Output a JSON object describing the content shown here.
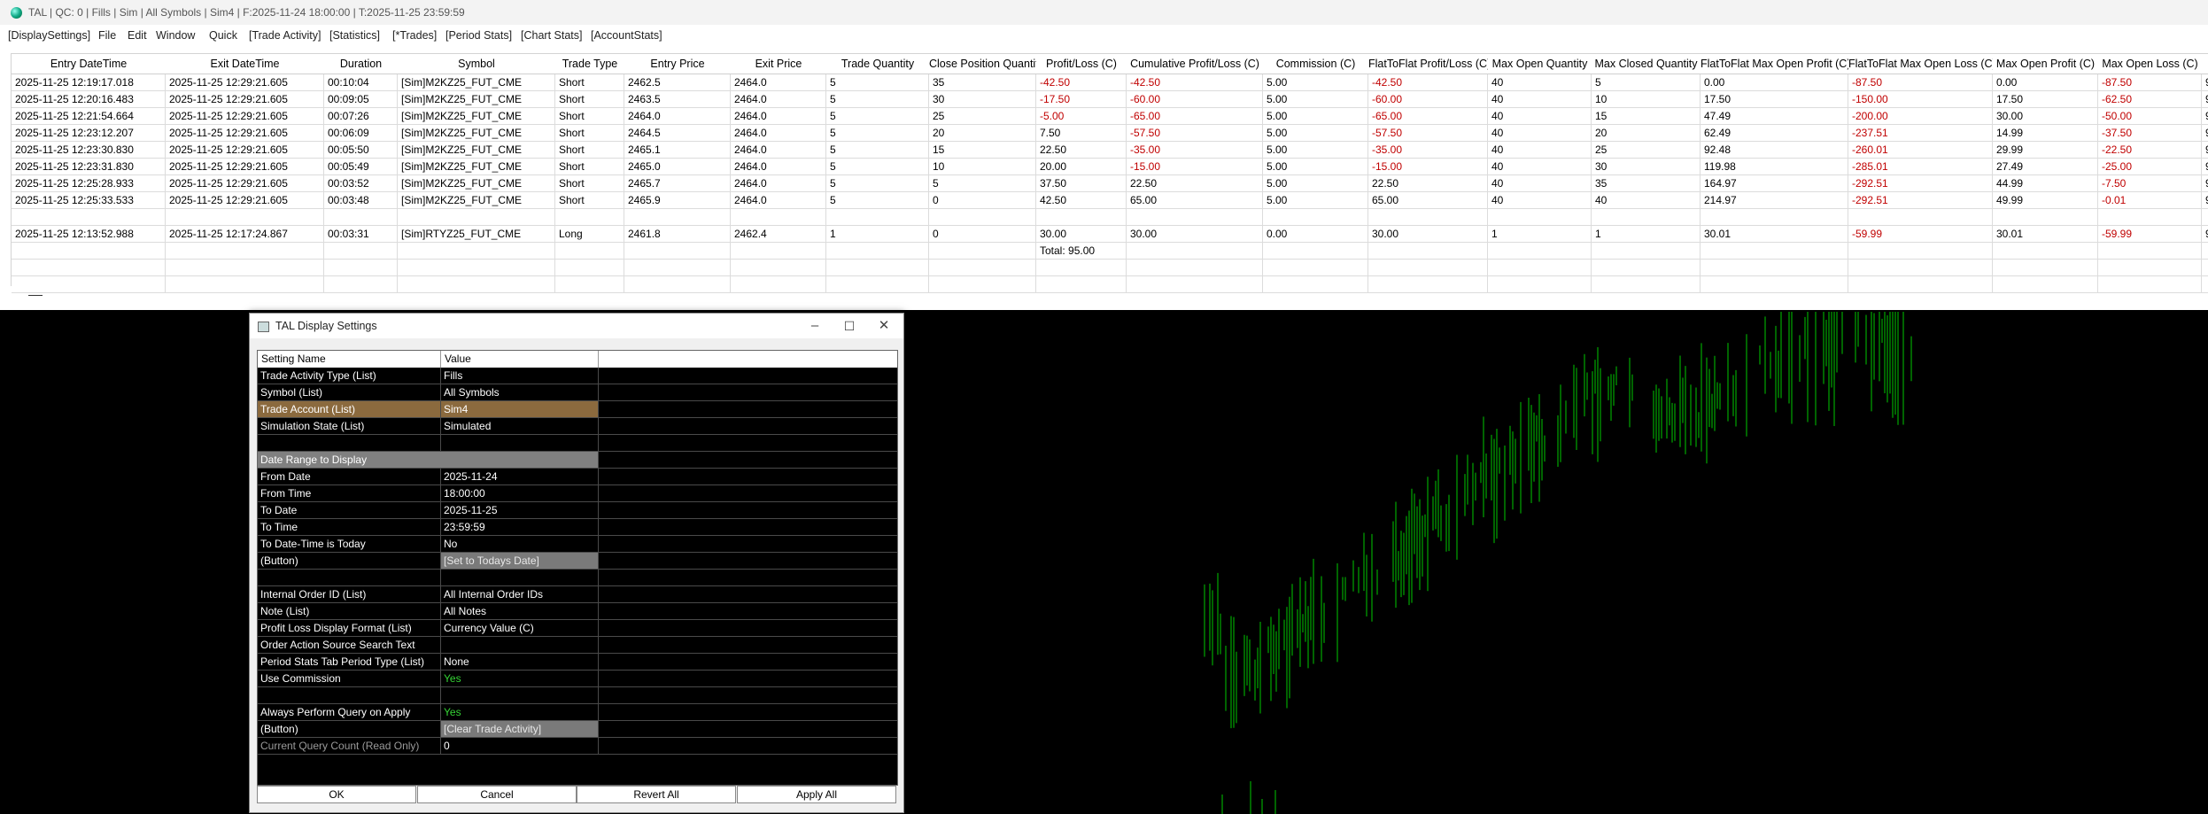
{
  "window": {
    "title": "TAL | QC: 0 | Fills | Sim | All Symbols | Sim4 | F:2025-11-24  18:00:00 | T:2025-11-25  23:59:59"
  },
  "menu": [
    "[DisplaySettings]",
    "File",
    "Edit",
    "Window",
    "Quick",
    "[Trade Activity]",
    "[Statistics]",
    "[*Trades]",
    "[Period Stats]",
    "[Chart Stats]",
    "[AccountStats]"
  ],
  "table": {
    "headers": [
      "Entry DateTime",
      "Exit DateTime",
      "Duration",
      "Symbol",
      "Trade Type",
      "Entry Price",
      "Exit Price",
      "Trade Quantity",
      "Close Position Quantity",
      "Profit/Loss (C)",
      "Cumulative Profit/Loss (C)",
      "Commission (C)",
      "FlatToFlat Profit/Loss (C)",
      "Max Open Quantity",
      "Max Closed Quantity",
      "FlatToFlat Max Open Profit (C)",
      "FlatToFlat Max Open Loss (C)",
      "Max Open Profit (C)",
      "Max Open Loss (C)",
      ""
    ],
    "rows": [
      [
        "2025-11-25  12:19:17.018",
        "2025-11-25  12:29:21.605",
        "00:10:04",
        "[Sim]M2KZ25_FUT_CME",
        "Short",
        "2462.5",
        "2464.0",
        "5",
        "35",
        "-42.50",
        "-42.50",
        "5.00",
        "-42.50",
        "40",
        "5",
        "0.00",
        "-87.50",
        "0.00",
        "-87.50",
        "9"
      ],
      [
        "2025-11-25  12:20:16.483",
        "2025-11-25  12:29:21.605",
        "00:09:05",
        "[Sim]M2KZ25_FUT_CME",
        "Short",
        "2463.5",
        "2464.0",
        "5",
        "30",
        "-17.50",
        "-60.00",
        "5.00",
        "-60.00",
        "40",
        "10",
        "17.50",
        "-150.00",
        "17.50",
        "-62.50",
        "9"
      ],
      [
        "2025-11-25  12:21:54.664",
        "2025-11-25  12:29:21.605",
        "00:07:26",
        "[Sim]M2KZ25_FUT_CME",
        "Short",
        "2464.0",
        "2464.0",
        "5",
        "25",
        "-5.00",
        "-65.00",
        "5.00",
        "-65.00",
        "40",
        "15",
        "47.49",
        "-200.00",
        "30.00",
        "-50.00",
        "9"
      ],
      [
        "2025-11-25  12:23:12.207",
        "2025-11-25  12:29:21.605",
        "00:06:09",
        "[Sim]M2KZ25_FUT_CME",
        "Short",
        "2464.5",
        "2464.0",
        "5",
        "20",
        "7.50",
        "-57.50",
        "5.00",
        "-57.50",
        "40",
        "20",
        "62.49",
        "-237.51",
        "14.99",
        "-37.50",
        "9"
      ],
      [
        "2025-11-25  12:23:30.830",
        "2025-11-25  12:29:21.605",
        "00:05:50",
        "[Sim]M2KZ25_FUT_CME",
        "Short",
        "2465.1",
        "2464.0",
        "5",
        "15",
        "22.50",
        "-35.00",
        "5.00",
        "-35.00",
        "40",
        "25",
        "92.48",
        "-260.01",
        "29.99",
        "-22.50",
        "9"
      ],
      [
        "2025-11-25  12:23:31.830",
        "2025-11-25  12:29:21.605",
        "00:05:49",
        "[Sim]M2KZ25_FUT_CME",
        "Short",
        "2465.0",
        "2464.0",
        "5",
        "10",
        "20.00",
        "-15.00",
        "5.00",
        "-15.00",
        "40",
        "30",
        "119.98",
        "-285.01",
        "27.49",
        "-25.00",
        "9"
      ],
      [
        "2025-11-25  12:25:28.933",
        "2025-11-25  12:29:21.605",
        "00:03:52",
        "[Sim]M2KZ25_FUT_CME",
        "Short",
        "2465.7",
        "2464.0",
        "5",
        "5",
        "37.50",
        "22.50",
        "5.00",
        "22.50",
        "40",
        "35",
        "164.97",
        "-292.51",
        "44.99",
        "-7.50",
        "9"
      ],
      [
        "2025-11-25  12:25:33.533",
        "2025-11-25  12:29:21.605",
        "00:03:48",
        "[Sim]M2KZ25_FUT_CME",
        "Short",
        "2465.9",
        "2464.0",
        "5",
        "0",
        "42.50",
        "65.00",
        "5.00",
        "65.00",
        "40",
        "40",
        "214.97",
        "-292.51",
        "49.99",
        "-0.01",
        "9"
      ],
      [
        "",
        "",
        "",
        "",
        "",
        "",
        "",
        "",
        "",
        "",
        "",
        "",
        "",
        "",
        "",
        "",
        "",
        "",
        "",
        ""
      ],
      [
        "2025-11-25  12:13:52.988",
        "2025-11-25  12:17:24.867",
        "00:03:31",
        "[Sim]RTYZ25_FUT_CME",
        "Long",
        "2461.8",
        "2462.4",
        "1",
        "0",
        "30.00",
        "30.00",
        "0.00",
        "30.00",
        "1",
        "1",
        "30.01",
        "-59.99",
        "30.01",
        "-59.99",
        "9"
      ],
      [
        "",
        "",
        "",
        "",
        "",
        "",
        "",
        "",
        "",
        "Total: 95.00",
        "",
        "",
        "",
        "",
        "",
        "",
        "",
        "",
        "",
        ""
      ],
      [
        "",
        "",
        "",
        "",
        "",
        "",
        "",
        "",
        "",
        "",
        "",
        "",
        "",
        "",
        "",
        "",
        "",
        "",
        "",
        ""
      ],
      [
        "",
        "",
        "",
        "",
        "",
        "",
        "",
        "",
        "",
        "",
        "",
        "",
        "",
        "",
        "",
        "",
        "",
        "",
        "",
        ""
      ]
    ]
  },
  "dialog": {
    "title": "TAL Display Settings",
    "controls": {
      "minimize": "–",
      "maximize": "☐",
      "close": "✕"
    },
    "col_name": "Setting Name",
    "col_value": "Value",
    "rows": [
      {
        "name": "Trade Activity Type (List)",
        "value": "Fills"
      },
      {
        "name": "Symbol (List)",
        "value": "All Symbols"
      },
      {
        "name": "Trade Account (List)",
        "value": "Sim4",
        "highlight": true
      },
      {
        "name": "Simulation State (List)",
        "value": "Simulated"
      },
      {
        "name": "",
        "value": ""
      },
      {
        "name": "Date Range to Display",
        "value": "",
        "section": true
      },
      {
        "name": "From Date",
        "value": "2025-11-24"
      },
      {
        "name": "From Time",
        "value": "18:00:00"
      },
      {
        "name": "To Date",
        "value": "2025-11-25"
      },
      {
        "name": "To Time",
        "value": "23:59:59"
      },
      {
        "name": "To Date-Time is Today",
        "value": "No"
      },
      {
        "name": " (Button)",
        "value": "[Set to Todays Date]",
        "button": true
      },
      {
        "name": "",
        "value": ""
      },
      {
        "name": "Internal Order ID (List)",
        "value": "All Internal Order IDs"
      },
      {
        "name": "Note (List)",
        "value": "All Notes"
      },
      {
        "name": "Profit Loss Display Format (List)",
        "value": "Currency Value (C)"
      },
      {
        "name": "Order Action Source Search Text",
        "value": ""
      },
      {
        "name": "Period Stats Tab Period Type (List)",
        "value": "None"
      },
      {
        "name": "Use Commission",
        "value": "Yes",
        "green": true
      },
      {
        "name": "",
        "value": ""
      },
      {
        "name": "Always Perform Query on Apply",
        "value": "Yes",
        "green": true
      },
      {
        "name": " (Button)",
        "value": "[Clear Trade Activity]",
        "button": true
      },
      {
        "name": "Current Query Count (Read Only)",
        "value": "0",
        "readonly": true
      }
    ],
    "buttons": [
      "OK",
      "Cancel",
      "Revert All",
      "Apply All"
    ]
  },
  "colors": {
    "negative": "#c00000",
    "chart_bars": "#00c800",
    "highlight_row": "#8b6a3e",
    "yes_value": "#35d435"
  }
}
